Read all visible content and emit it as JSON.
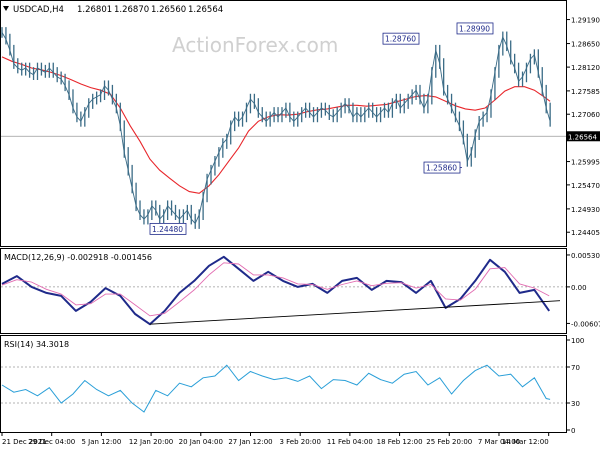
{
  "chart_data": [
    {
      "type": "candlestick",
      "panel": "price",
      "header": {
        "symbol": "USDCAD,H4",
        "open": "1.26801",
        "high": "1.26870",
        "low": "1.26560",
        "close": "1.26564"
      },
      "watermark": "ActionForex.com",
      "y_ticks": [
        "1.29190",
        "1.28650",
        "1.28120",
        "1.27585",
        "1.27060",
        "1.26530",
        "1.25995",
        "1.25470",
        "1.24930",
        "1.24405"
      ],
      "ylim": [
        1.2414,
        1.2945
      ],
      "last_price_label": "1.26564",
      "annotations": [
        {
          "label": "1.24480",
          "value": 1.2448
        },
        {
          "label": "1.28760",
          "value": 1.2876
        },
        {
          "label": "1.28990",
          "value": 1.2899
        },
        {
          "label": "1.25860",
          "value": 1.2586
        }
      ],
      "series": [
        {
          "name": "",
          "kind": "close-approx",
          "x": [
            0,
            4,
            8,
            12,
            16,
            20,
            24,
            28,
            32,
            36,
            40,
            44,
            48,
            52,
            56,
            60,
            64,
            68,
            72,
            76,
            80,
            84,
            88,
            92,
            96,
            100,
            104,
            108,
            112,
            116,
            120,
            124,
            128,
            132,
            136,
            140,
            144,
            148,
            152,
            156,
            160,
            164,
            168,
            172,
            176,
            180,
            184,
            188,
            192,
            196,
            200,
            204,
            208,
            212,
            216,
            220,
            224,
            228,
            232,
            236,
            240,
            244,
            248,
            252,
            256,
            260,
            264,
            268,
            272,
            276,
            280,
            284,
            288,
            292,
            296,
            300,
            304,
            308,
            312,
            316,
            320,
            324,
            328,
            332,
            336,
            340,
            344,
            348,
            352,
            356,
            360,
            364,
            368,
            372,
            376,
            380,
            384,
            388,
            392,
            396,
            400,
            404,
            408,
            412,
            416,
            420,
            424,
            428,
            432,
            436,
            440,
            444,
            448,
            452,
            456,
            460,
            464,
            468,
            472,
            476,
            480,
            484,
            488,
            492,
            496,
            500,
            504,
            508,
            512,
            516,
            520,
            524,
            528,
            532,
            536,
            540,
            544,
            548,
            552,
            556
          ],
          "values": [
            1.289,
            1.2875,
            1.285,
            1.282,
            1.281,
            1.2805,
            1.281,
            1.28,
            1.2795,
            1.281,
            1.2805,
            1.28,
            1.281,
            1.28,
            1.279,
            1.2785,
            1.277,
            1.275,
            1.272,
            1.27,
            1.269,
            1.271,
            1.273,
            1.274,
            1.2745,
            1.275,
            1.277,
            1.276,
            1.274,
            1.272,
            1.268,
            1.262,
            1.258,
            1.254,
            1.25,
            1.248,
            1.247,
            1.248,
            1.25,
            1.249,
            1.247,
            1.248,
            1.25,
            1.249,
            1.248,
            1.247,
            1.248,
            1.249,
            1.247,
            1.246,
            1.248,
            1.252,
            1.256,
            1.258,
            1.26,
            1.262,
            1.264,
            1.265,
            1.268,
            1.27,
            1.269,
            1.27,
            1.272,
            1.274,
            1.273,
            1.271,
            1.27,
            1.269,
            1.27,
            1.271,
            1.27,
            1.271,
            1.272,
            1.27,
            1.269,
            1.27,
            1.271,
            1.272,
            1.271,
            1.27,
            1.271,
            1.272,
            1.2715,
            1.2705,
            1.27,
            1.271,
            1.272,
            1.273,
            1.272,
            1.27,
            1.271,
            1.27,
            1.271,
            1.272,
            1.271,
            1.27,
            1.271,
            1.272,
            1.271,
            1.273,
            1.274,
            1.272,
            1.273,
            1.274,
            1.275,
            1.276,
            1.274,
            1.272,
            1.274,
            1.28,
            1.285,
            1.282,
            1.276,
            1.274,
            1.272,
            1.27,
            1.268,
            1.265,
            1.26,
            1.262,
            1.266,
            1.269,
            1.27,
            1.271,
            1.275,
            1.28,
            1.285,
            1.288,
            1.286,
            1.283,
            1.281,
            1.278,
            1.279,
            1.281,
            1.283,
            1.284,
            1.28,
            1.276,
            1.272,
            1.269
          ]
        },
        {
          "name": "",
          "kind": "moving-average",
          "color": "#e8262b",
          "x": [
            0,
            10,
            20,
            30,
            40,
            50,
            60,
            70,
            80,
            90,
            100,
            110,
            120,
            130,
            140,
            150,
            160,
            170,
            180,
            190,
            200,
            210,
            220,
            230,
            240,
            250,
            260,
            270,
            280,
            290,
            300,
            310,
            320,
            330,
            340,
            350,
            360,
            370,
            380,
            390,
            400,
            410,
            420,
            430,
            440,
            450,
            460,
            470,
            480,
            490,
            500,
            510,
            520,
            530,
            540,
            550,
            556
          ],
          "values": [
            1.2835,
            1.2825,
            1.2818,
            1.281,
            1.2806,
            1.28,
            1.2793,
            1.2784,
            1.2774,
            1.2766,
            1.276,
            1.2751,
            1.272,
            1.268,
            1.2645,
            1.2605,
            1.258,
            1.2562,
            1.2545,
            1.2532,
            1.2528,
            1.2545,
            1.257,
            1.26,
            1.263,
            1.2668,
            1.269,
            1.27,
            1.2705,
            1.2704,
            1.2706,
            1.2712,
            1.2716,
            1.2718,
            1.2722,
            1.2726,
            1.2726,
            1.2724,
            1.2726,
            1.2728,
            1.2734,
            1.274,
            1.2746,
            1.2748,
            1.2745,
            1.2735,
            1.2725,
            1.2718,
            1.2715,
            1.272,
            1.2738,
            1.2758,
            1.2768,
            1.2768,
            1.276,
            1.2745,
            1.2735
          ]
        }
      ]
    },
    {
      "type": "line",
      "panel": "macd",
      "header": "MACD(12,26,9) -0.002918 -0.001456",
      "y_ticks": [
        "0.005307",
        "0.00",
        "-0.006074"
      ],
      "ylim": [
        -0.0075,
        0.0058
      ],
      "series": [
        {
          "name": "",
          "kind": "macd",
          "color": "#1f2a8a",
          "x": [
            0,
            15,
            30,
            45,
            60,
            75,
            90,
            105,
            120,
            135,
            150,
            165,
            180,
            195,
            210,
            225,
            240,
            255,
            270,
            285,
            300,
            315,
            330,
            345,
            360,
            375,
            390,
            405,
            420,
            435,
            450,
            465,
            480,
            495,
            510,
            525,
            540,
            555
          ],
          "values": [
            0.0005,
            0.0018,
            0.0,
            -0.001,
            -0.0015,
            -0.004,
            -0.0025,
            -0.0002,
            -0.0015,
            -0.0045,
            -0.0062,
            -0.004,
            -0.001,
            0.001,
            0.0035,
            0.005,
            0.003,
            0.001,
            0.0025,
            0.001,
            0.0,
            0.0005,
            -0.001,
            0.001,
            0.0015,
            -0.0005,
            0.001,
            0.0008,
            -0.001,
            0.001,
            -0.0035,
            -0.002,
            0.001,
            0.0045,
            0.0025,
            -0.001,
            -0.0005,
            -0.004
          ]
        },
        {
          "name": "",
          "kind": "signal",
          "color": "#e26cb1",
          "x": [
            0,
            15,
            30,
            45,
            60,
            75,
            90,
            105,
            120,
            135,
            150,
            165,
            180,
            195,
            210,
            225,
            240,
            255,
            270,
            285,
            300,
            315,
            330,
            345,
            360,
            375,
            390,
            405,
            420,
            435,
            450,
            465,
            480,
            495,
            510,
            525,
            540,
            555
          ],
          "values": [
            0.0003,
            0.0012,
            0.0008,
            -0.0004,
            -0.0012,
            -0.003,
            -0.0028,
            -0.0012,
            -0.0012,
            -0.003,
            -0.0048,
            -0.0044,
            -0.0025,
            -0.0005,
            0.002,
            0.004,
            0.0038,
            0.002,
            0.002,
            0.0015,
            0.0005,
            0.0004,
            -0.0004,
            0.0004,
            0.001,
            0.0002,
            0.0006,
            0.0007,
            -0.0002,
            0.0004,
            -0.002,
            -0.0022,
            -0.0004,
            0.003,
            0.0032,
            0.0005,
            -0.0002,
            -0.0015
          ]
        },
        {
          "name": "",
          "kind": "trendline",
          "color": "#000000",
          "x": [
            150,
            566
          ],
          "values": [
            -0.0062,
            -0.0023
          ]
        }
      ]
    },
    {
      "type": "line",
      "panel": "rsi",
      "header": "RSI(14) 34.3018",
      "y_ticks": [
        "100",
        "70",
        "30",
        "0"
      ],
      "ylim": [
        0,
        100
      ],
      "levels": [
        30,
        70
      ],
      "series": [
        {
          "name": "",
          "color": "#2a9fd8",
          "x": [
            0,
            12,
            24,
            36,
            48,
            60,
            72,
            84,
            96,
            108,
            120,
            132,
            144,
            156,
            168,
            180,
            192,
            204,
            216,
            228,
            240,
            252,
            264,
            276,
            288,
            300,
            312,
            324,
            336,
            348,
            360,
            372,
            384,
            396,
            408,
            420,
            432,
            444,
            456,
            468,
            480,
            492,
            504,
            516,
            528,
            540,
            552,
            556
          ],
          "values": [
            50,
            42,
            45,
            38,
            47,
            30,
            40,
            55,
            45,
            38,
            44,
            30,
            20,
            44,
            38,
            52,
            48,
            58,
            60,
            72,
            55,
            65,
            60,
            56,
            58,
            54,
            60,
            46,
            56,
            55,
            50,
            63,
            56,
            52,
            62,
            65,
            50,
            58,
            40,
            55,
            66,
            72,
            60,
            62,
            48,
            58,
            35,
            34
          ]
        }
      ]
    }
  ],
  "x_axis_labels": [
    "21 Dec 2021",
    "29 Dec 04:00",
    "5 Jan 12:00",
    "12 Jan 20:00",
    "20 Jan 04:00",
    "27 Jan 12:00",
    "3 Feb 20:00",
    "11 Feb 04:00",
    "18 Feb 12:00",
    "25 Feb 20:00",
    "7 Mar 04:00",
    "14 Mar 12:00"
  ],
  "colors": {
    "price_line": "#3a6b86",
    "ma": "#e8262b",
    "macd": "#1f2a8a",
    "signal": "#e26cb1",
    "rsi": "#2a9fd8"
  }
}
